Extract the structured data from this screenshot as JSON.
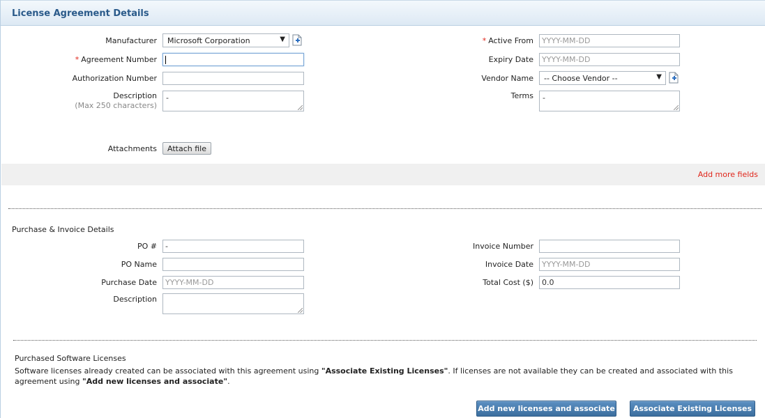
{
  "header": {
    "title": "License Agreement Details"
  },
  "license": {
    "manufacturer": {
      "label": "Manufacturer",
      "value": "Microsoft Corporation"
    },
    "agreement_number": {
      "required_mark": "*",
      "label": "Agreement Number",
      "value": ""
    },
    "authorization_number": {
      "label": "Authorization Number",
      "value": ""
    },
    "description": {
      "label": "Description",
      "hint": "(Max 250 characters)",
      "value": "-"
    },
    "attachments": {
      "label": "Attachments",
      "button": "Attach file"
    },
    "active_from": {
      "required_mark": "*",
      "label": "Active From",
      "placeholder": "YYYY-MM-DD"
    },
    "expiry_date": {
      "label": "Expiry Date",
      "placeholder": "YYYY-MM-DD"
    },
    "vendor_name": {
      "label": "Vendor Name",
      "value": "-- Choose Vendor --"
    },
    "terms": {
      "label": "Terms",
      "value": "-"
    }
  },
  "add_more_fields": "Add more fields",
  "purchase": {
    "section_title": "Purchase & Invoice Details",
    "po_number": {
      "label": "PO #",
      "value": "-"
    },
    "po_name": {
      "label": "PO Name",
      "value": ""
    },
    "purchase_date": {
      "label": "Purchase Date",
      "placeholder": "YYYY-MM-DD"
    },
    "description": {
      "label": "Description",
      "value": ""
    },
    "invoice_number": {
      "label": "Invoice Number",
      "value": ""
    },
    "invoice_date": {
      "label": "Invoice Date",
      "placeholder": "YYYY-MM-DD"
    },
    "total_cost": {
      "label": "Total Cost ($)",
      "value": "0.0"
    }
  },
  "software": {
    "section_title": "Purchased Software Licenses",
    "desc_part1": "Software licenses already created can be associated with this agreement using ",
    "desc_bold1": "\"Associate Existing Licenses\"",
    "desc_part2": ". If licenses are not available they can be created and associated with this agreement using ",
    "desc_bold2": "\"Add new licenses and associate\"",
    "desc_part3": ".",
    "btn_add_new": "Add new licenses and associate",
    "btn_associate": "Associate Existing Licenses"
  },
  "icons": {
    "add": "add-document-icon",
    "dropdown": "dropdown-arrow-icon"
  },
  "colors": {
    "required": "#e0261b",
    "header_text": "#2a5a8a",
    "button_blue": "#4a7db0"
  }
}
